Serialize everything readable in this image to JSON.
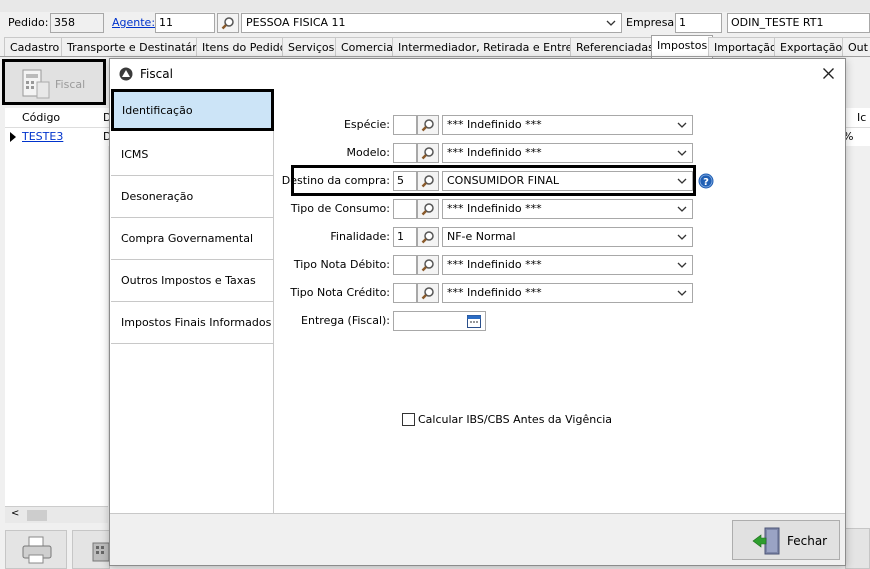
{
  "header": {
    "pedido_label": "Pedido:",
    "pedido_value": "358",
    "agente_label": "Agente:",
    "agente_value": "11",
    "agente_name": "PESSOA FISICA 11",
    "empresa_label": "Empresa:",
    "empresa_value": "1",
    "empresa_name": "ODIN_TESTE RT1"
  },
  "tabs": [
    {
      "label": "Cadastro"
    },
    {
      "label": "Transporte e Destinatário"
    },
    {
      "label": "Itens do Pedido"
    },
    {
      "label": "Serviços"
    },
    {
      "label": "Comercial"
    },
    {
      "label": "Intermediador, Retirada e Entrega"
    },
    {
      "label": "Referenciadas"
    },
    {
      "label": "Impostos"
    },
    {
      "label": "Importação"
    },
    {
      "label": "Exportação"
    },
    {
      "label": "Out"
    }
  ],
  "left_panel": {
    "fiscal_button": "Fiscal",
    "col_codigo": "Código",
    "col_d": "D",
    "row_codigo": "TESTE3",
    "row_d": "D",
    "right_col": "Ic",
    "right_pct": "%"
  },
  "dialog": {
    "title": "Fiscal",
    "close_glyph": "✕",
    "sidebar": [
      {
        "label": "Identificação"
      },
      {
        "label": "ICMS"
      },
      {
        "label": "Desoneração"
      },
      {
        "label": "Compra Governamental"
      },
      {
        "label": "Outros Impostos e Taxas"
      },
      {
        "label": "Impostos Finais Informados"
      }
    ],
    "fields": {
      "especie": {
        "label": "Espécie:",
        "code": "",
        "value": "*** Indefinido ***"
      },
      "modelo": {
        "label": "Modelo:",
        "code": "",
        "value": "*** Indefinido ***"
      },
      "destino": {
        "label": "Destino da compra:",
        "code": "5",
        "value": "CONSUMIDOR FINAL"
      },
      "tipo_consumo": {
        "label": "Tipo de Consumo:",
        "code": "",
        "value": "*** Indefinido ***"
      },
      "finalidade": {
        "label": "Finalidade:",
        "code": "1",
        "value": "NF-e Normal"
      },
      "tipo_debito": {
        "label": "Tipo Nota Débito:",
        "code": "",
        "value": "*** Indefinido ***"
      },
      "tipo_credito": {
        "label": "Tipo Nota Crédito:",
        "code": "",
        "value": "*** Indefinido ***"
      },
      "entrega": {
        "label": "Entrega (Fiscal):",
        "value": ""
      }
    },
    "checkbox_label": "Calcular IBS/CBS Antes da Vigência",
    "fechar_label": "Fechar"
  },
  "colors": {
    "accent_selected": "#cce4f7",
    "highlight_border": "#000000",
    "link": "#0033cc",
    "help_icon": "#1f5fb4"
  }
}
